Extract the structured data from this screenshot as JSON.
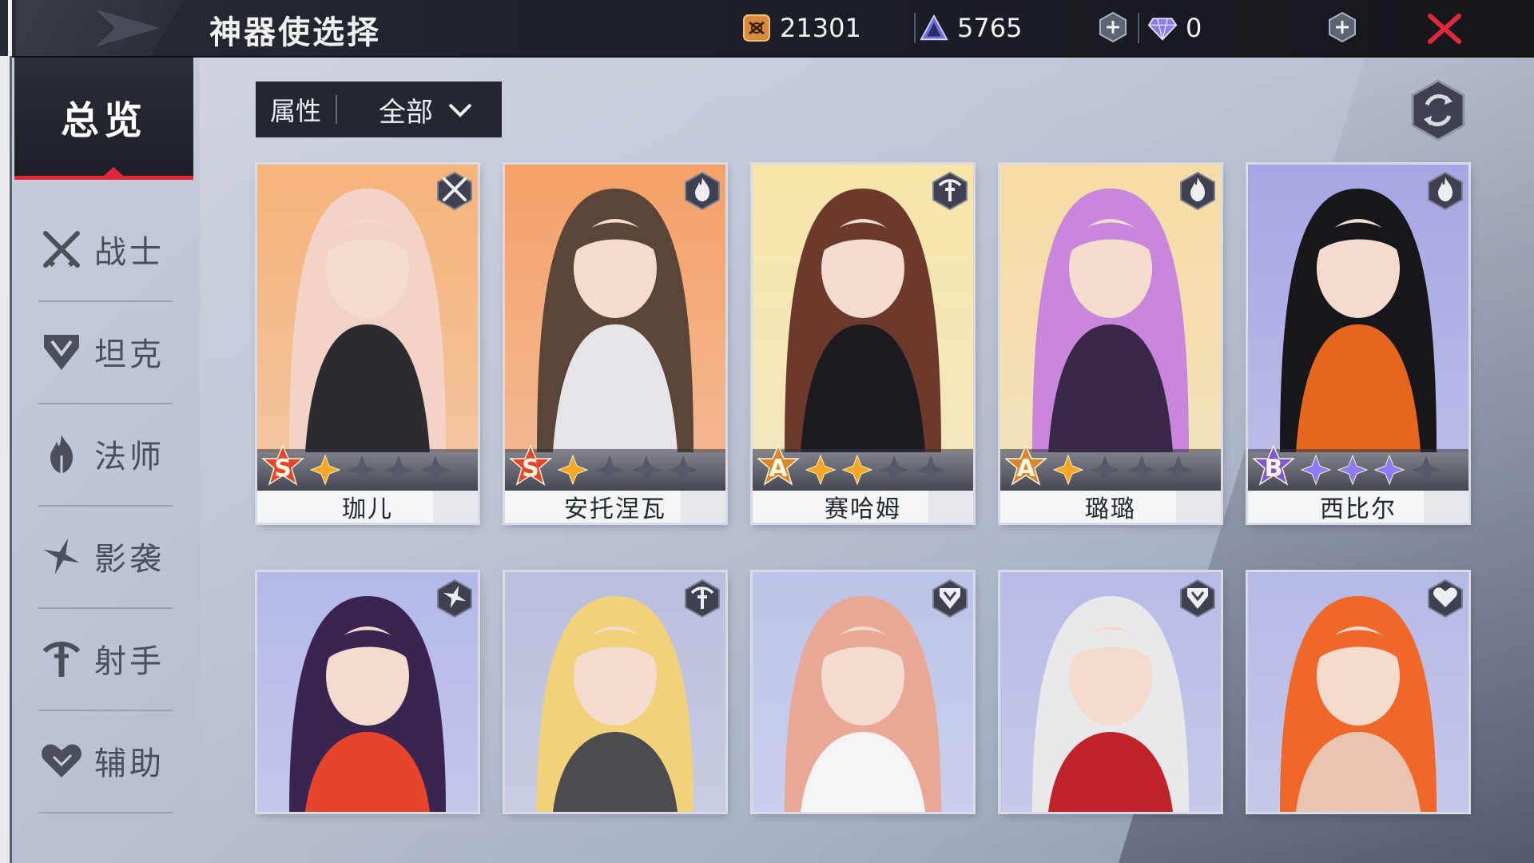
{
  "header": {
    "title": "神器使选择",
    "currencies": [
      {
        "icon": "coin-token-icon",
        "value": "21301"
      },
      {
        "icon": "crystal-pyramid-icon",
        "value": "5765"
      },
      {
        "icon": "diamond-gem-icon",
        "value": "0"
      }
    ]
  },
  "sidebar": {
    "overview_label": "总览",
    "items": [
      {
        "label": "战士",
        "icon": "crossed-swords-icon"
      },
      {
        "label": "坦克",
        "icon": "shield-helmet-icon"
      },
      {
        "label": "法师",
        "icon": "flame-staff-icon"
      },
      {
        "label": "影袭",
        "icon": "shuriken-icon"
      },
      {
        "label": "射手",
        "icon": "crossbow-icon"
      },
      {
        "label": "辅助",
        "icon": "heart-icon"
      }
    ]
  },
  "filter": {
    "label": "属性",
    "value": "全部"
  },
  "cards": [
    {
      "name": "珈儿",
      "rank": "S",
      "stars": 1,
      "class_icon": "crossed-swords-icon",
      "rank_color": "#e5452d",
      "palette": [
        "#f6b37a",
        "#f3d3c7",
        "#2d2a30"
      ]
    },
    {
      "name": "安托涅瓦",
      "rank": "S",
      "stars": 1,
      "class_icon": "flame-staff-icon",
      "rank_color": "#e5452d",
      "palette": [
        "#f6a168",
        "#5a4538",
        "#e7e3ea"
      ]
    },
    {
      "name": "赛哈姆",
      "rank": "A",
      "stars": 2,
      "class_icon": "crossbow-icon",
      "rank_color": "#d8872e",
      "palette": [
        "#f7e5a8",
        "#6c3a2c",
        "#1d1b20"
      ]
    },
    {
      "name": "璐璐",
      "rank": "A",
      "stars": 1,
      "class_icon": "flame-staff-icon",
      "rank_color": "#d8872e",
      "palette": [
        "#f6dca4",
        "#c886dc",
        "#3a2848"
      ]
    },
    {
      "name": "西比尔",
      "rank": "B",
      "stars": 3,
      "class_icon": "flame-staff-icon",
      "rank_color": "#7a58d8",
      "palette": [
        "#a7a6e4",
        "#17161b",
        "#e5661c"
      ]
    },
    {
      "name": "",
      "rank": "",
      "stars": 0,
      "class_icon": "shuriken-icon",
      "rank_color": "",
      "palette": [
        "#b4b8e8",
        "#3a2452",
        "#e6452b"
      ]
    },
    {
      "name": "",
      "rank": "",
      "stars": 0,
      "class_icon": "crossbow-icon",
      "rank_color": "",
      "palette": [
        "#b9bfdc",
        "#f1d27a",
        "#4d4a50"
      ]
    },
    {
      "name": "",
      "rank": "",
      "stars": 0,
      "class_icon": "shield-helmet-icon",
      "rank_color": "",
      "palette": [
        "#bcc3e8",
        "#e9a896",
        "#f4f4f4"
      ]
    },
    {
      "name": "",
      "rank": "",
      "stars": 0,
      "class_icon": "shield-helmet-icon",
      "rank_color": "",
      "palette": [
        "#b8bbe6",
        "#e9e9ec",
        "#c0242a"
      ]
    },
    {
      "name": "",
      "rank": "",
      "stars": 0,
      "class_icon": "heart-icon",
      "rank_color": "",
      "palette": [
        "#b5b9e6",
        "#f0672a",
        "#e8c4b0"
      ]
    }
  ]
}
